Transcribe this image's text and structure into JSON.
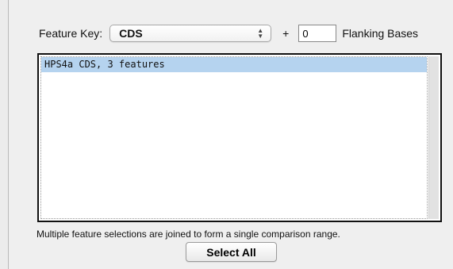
{
  "feature_key": {
    "label": "Feature Key:",
    "selected": "CDS"
  },
  "flanking": {
    "plus": "+",
    "value": "0",
    "label": "Flanking Bases"
  },
  "feature_list": {
    "items": [
      "HPS4a CDS, 3 features"
    ]
  },
  "note": "Multiple feature selections are joined to form a single comparison range.",
  "select_all_label": "Select All",
  "colors": {
    "selection_highlight": "#b5d3ef",
    "panel_background": "#efefef"
  }
}
